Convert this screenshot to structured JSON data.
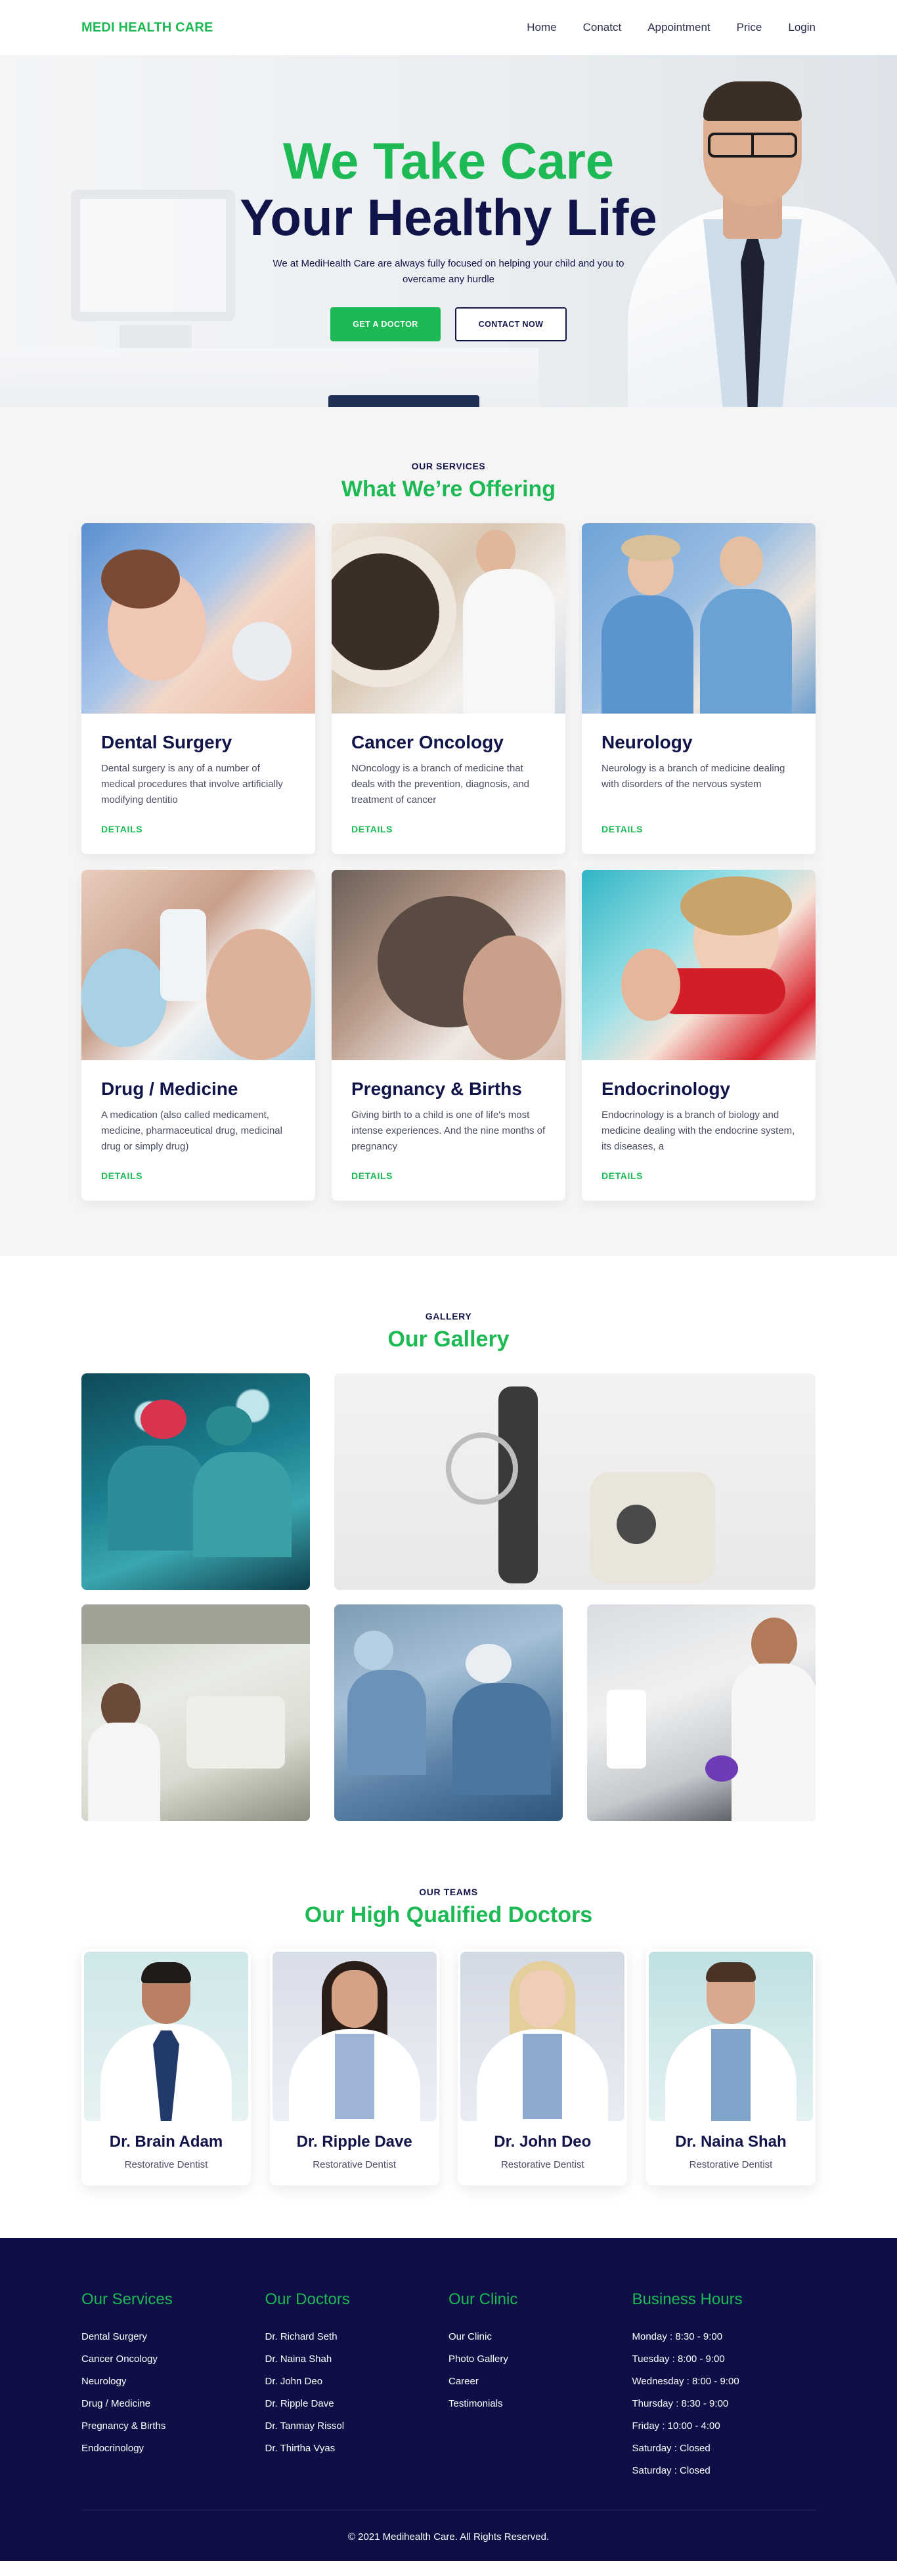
{
  "nav": {
    "logo": "MEDI HEALTH CARE",
    "links": [
      "Home",
      "Conatct",
      "Appointment",
      "Price",
      "Login"
    ]
  },
  "hero": {
    "line1": "We Take Care",
    "line2": "Your Healthy Life",
    "subtitle": "We at MediHealth Care are always fully focused on helping your child and you to overcame any hurdle",
    "primary_button": "GET A DOCTOR",
    "secondary_button": "CONTACT NOW"
  },
  "services": {
    "kicker": "OUR SERVICES",
    "title": "What We’re Offering",
    "items": [
      {
        "title": "Dental Surgery",
        "text": "Dental surgery is any of a number of medical procedures that involve artificially modifying dentitio",
        "link": "DETAILS"
      },
      {
        "title": "Cancer Oncology",
        "text": "NOncology is a branch of medicine that deals with the prevention, diagnosis, and treatment of cancer",
        "link": "DETAILS"
      },
      {
        "title": "Neurology",
        "text": "Neurology is a branch of medicine dealing with disorders of the nervous system",
        "link": "DETAILS"
      },
      {
        "title": "Drug / Medicine",
        "text": "A medication (also called medicament, medicine, pharmaceutical drug, medicinal drug or simply drug)",
        "link": "DETAILS"
      },
      {
        "title": "Pregnancy & Births",
        "text": "Giving birth to a child is one of life's most intense experiences. And the nine months of pregnancy",
        "link": "DETAILS"
      },
      {
        "title": "Endocrinology",
        "text": "Endocrinology is a branch of biology and medicine dealing with the endocrine system, its diseases, a",
        "link": "DETAILS"
      }
    ]
  },
  "gallery": {
    "kicker": "GALLERY",
    "title": "Our Gallery"
  },
  "teams": {
    "kicker": "OUR TEAMS",
    "title": "Our High Qualified Doctors",
    "doctors": [
      {
        "name": "Dr. Brain Adam",
        "role": "Restorative Dentist"
      },
      {
        "name": "Dr. Ripple Dave",
        "role": "Restorative Dentist"
      },
      {
        "name": "Dr. John Deo",
        "role": "Restorative Dentist"
      },
      {
        "name": "Dr. Naina Shah",
        "role": "Restorative Dentist"
      }
    ]
  },
  "footer": {
    "columns": [
      {
        "heading": "Our Services",
        "items": [
          "Dental Surgery",
          "Cancer Oncology",
          "Neurology",
          "Drug / Medicine",
          "Pregnancy & Births",
          "Endocrinology"
        ]
      },
      {
        "heading": "Our Doctors",
        "items": [
          "Dr. Richard Seth",
          "Dr. Naina Shah",
          "Dr. John Deo",
          "Dr. Ripple Dave",
          "Dr. Tanmay Rissol",
          "Dr. Thirtha Vyas"
        ]
      },
      {
        "heading": "Our Clinic",
        "items": [
          "Our Clinic",
          "Photo Gallery",
          "Career",
          "Testimonials"
        ]
      },
      {
        "heading": "Business Hours",
        "items": [
          "Monday : 8:30 - 9:00",
          "Tuesday : 8:00 - 9:00",
          "Wednesday : 8:00 - 9:00",
          "Thursday : 8:30 - 9:00",
          "Friday : 10:00 - 4:00",
          "Saturday : Closed",
          "Saturday : Closed"
        ]
      }
    ],
    "copyright": "© 2021 Medihealth Care. All Rights Reserved."
  }
}
